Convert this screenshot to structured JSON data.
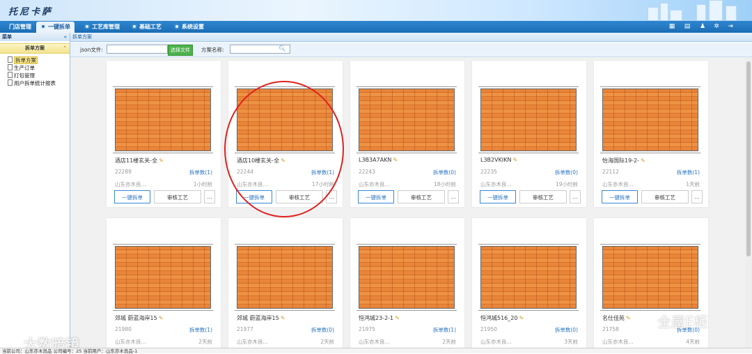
{
  "header": {
    "logo": "托尼卡萨"
  },
  "nav": {
    "items": [
      {
        "label": "门店管理"
      },
      {
        "label": "一键拆单"
      },
      {
        "label": "工艺库管理"
      },
      {
        "label": "基础工艺"
      },
      {
        "label": "系统设置"
      }
    ],
    "active": "一键拆单"
  },
  "tools": [
    {
      "icon": "calendar-icon"
    },
    {
      "icon": "document-icon"
    },
    {
      "icon": "user-icon"
    },
    {
      "icon": "gear-icon"
    },
    {
      "icon": "logout-icon"
    }
  ],
  "sidebar": {
    "title": "菜单",
    "collapse": "«",
    "section": "拆单方案",
    "section_chevron": "⌃",
    "items": [
      {
        "label": "拆单方案"
      },
      {
        "label": "生产订单"
      },
      {
        "label": "打包管理"
      },
      {
        "label": "用户拆单统计报表"
      }
    ]
  },
  "breadcrumb": "拆单方案",
  "toolbar": {
    "json_label": "json文件:",
    "json_value": "",
    "select_button": "选择文件",
    "name_label": "方案名称:",
    "name_value": ""
  },
  "card_labels": {
    "primary": "一键拆单",
    "secondary": "审核工艺",
    "more": "..."
  },
  "cards": [
    {
      "name": "酒店11楼玄关-全",
      "id": "22289",
      "count": "拆单数(1)",
      "company": "山东亦木良...",
      "time": "1小时前"
    },
    {
      "name": "酒店10楼玄关-全",
      "id": "22244",
      "count": "拆单数(1)",
      "company": "山东亦木良...",
      "time": "17小时前"
    },
    {
      "name": "L3B3A7AKN",
      "id": "22243",
      "count": "拆单数(0)",
      "company": "山东亦木良...",
      "time": "18小时前"
    },
    {
      "name": "L3B2VKIKN",
      "id": "22235",
      "count": "拆单数(0)",
      "company": "山东亦木良...",
      "time": "19小时前"
    },
    {
      "name": "怡海国际19-2-",
      "id": "22112",
      "count": "拆单数(1)",
      "company": "山东亦木良...",
      "time": "1天前"
    },
    {
      "name": "郊城 蔚蓝海岸15",
      "id": "21980",
      "count": "拆单数(1)",
      "company": "山东亦木良...",
      "time": "2天前"
    },
    {
      "name": "郊城 蔚蓝海岸15",
      "id": "21977",
      "count": "拆单数(0)",
      "company": "山东亦木良...",
      "time": "2天前"
    },
    {
      "name": "恒鸿城23-2-1",
      "id": "21975",
      "count": "拆单数(1)",
      "company": "山东亦木良...",
      "time": "2天前"
    },
    {
      "name": "恒鸿城516_20",
      "id": "21950",
      "count": "拆单数(0)",
      "company": "山东亦木良...",
      "time": "3天前"
    },
    {
      "name": "名仕佳苑",
      "id": "21758",
      "count": "拆单数(0)",
      "company": "山东亦木良...",
      "time": "4天前"
    }
  ],
  "statusbar": "当前公司：山东亦木良品   公司编号：25   当前用户：山东亦木良品-1",
  "watermarks": {
    "left": "大数暗镜",
    "right": "全屋E柜"
  }
}
